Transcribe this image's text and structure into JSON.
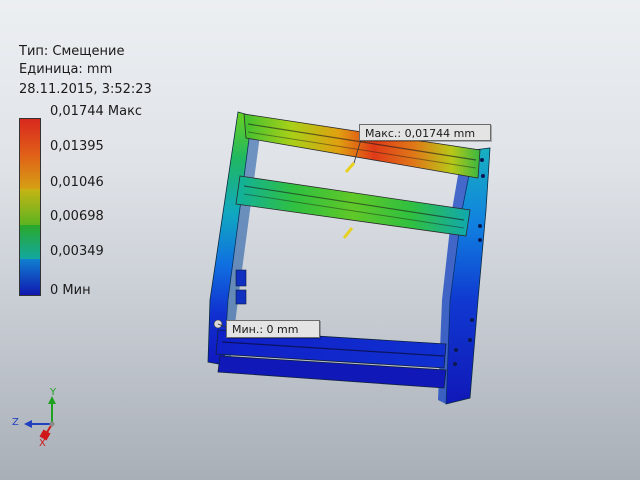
{
  "legend": {
    "type_label": "Тип: Смещение",
    "unit_label": "Единица: mm",
    "date": "28.11.2015, 3:52:23",
    "scale_labels": [
      "0,01744 Макс",
      "0,01395",
      "0,01046",
      "0,00698",
      "0,00349",
      "0 Мин"
    ],
    "scale_colors": [
      "#d8281e",
      "#e39b14",
      "#b8c214",
      "#22b02a",
      "#10b0a0",
      "#1060d8",
      "#1010b0"
    ]
  },
  "callouts": {
    "max": "Макс.: 0,01744 mm",
    "min": "Мин.: 0 mm"
  },
  "triad": {
    "x": "X",
    "y": "Y",
    "z": "Z"
  },
  "colors": {
    "max": "#e0281c",
    "min": "#1020c8",
    "x_axis": "#d01818",
    "y_axis": "#20a020",
    "z_axis": "#2040c0"
  }
}
